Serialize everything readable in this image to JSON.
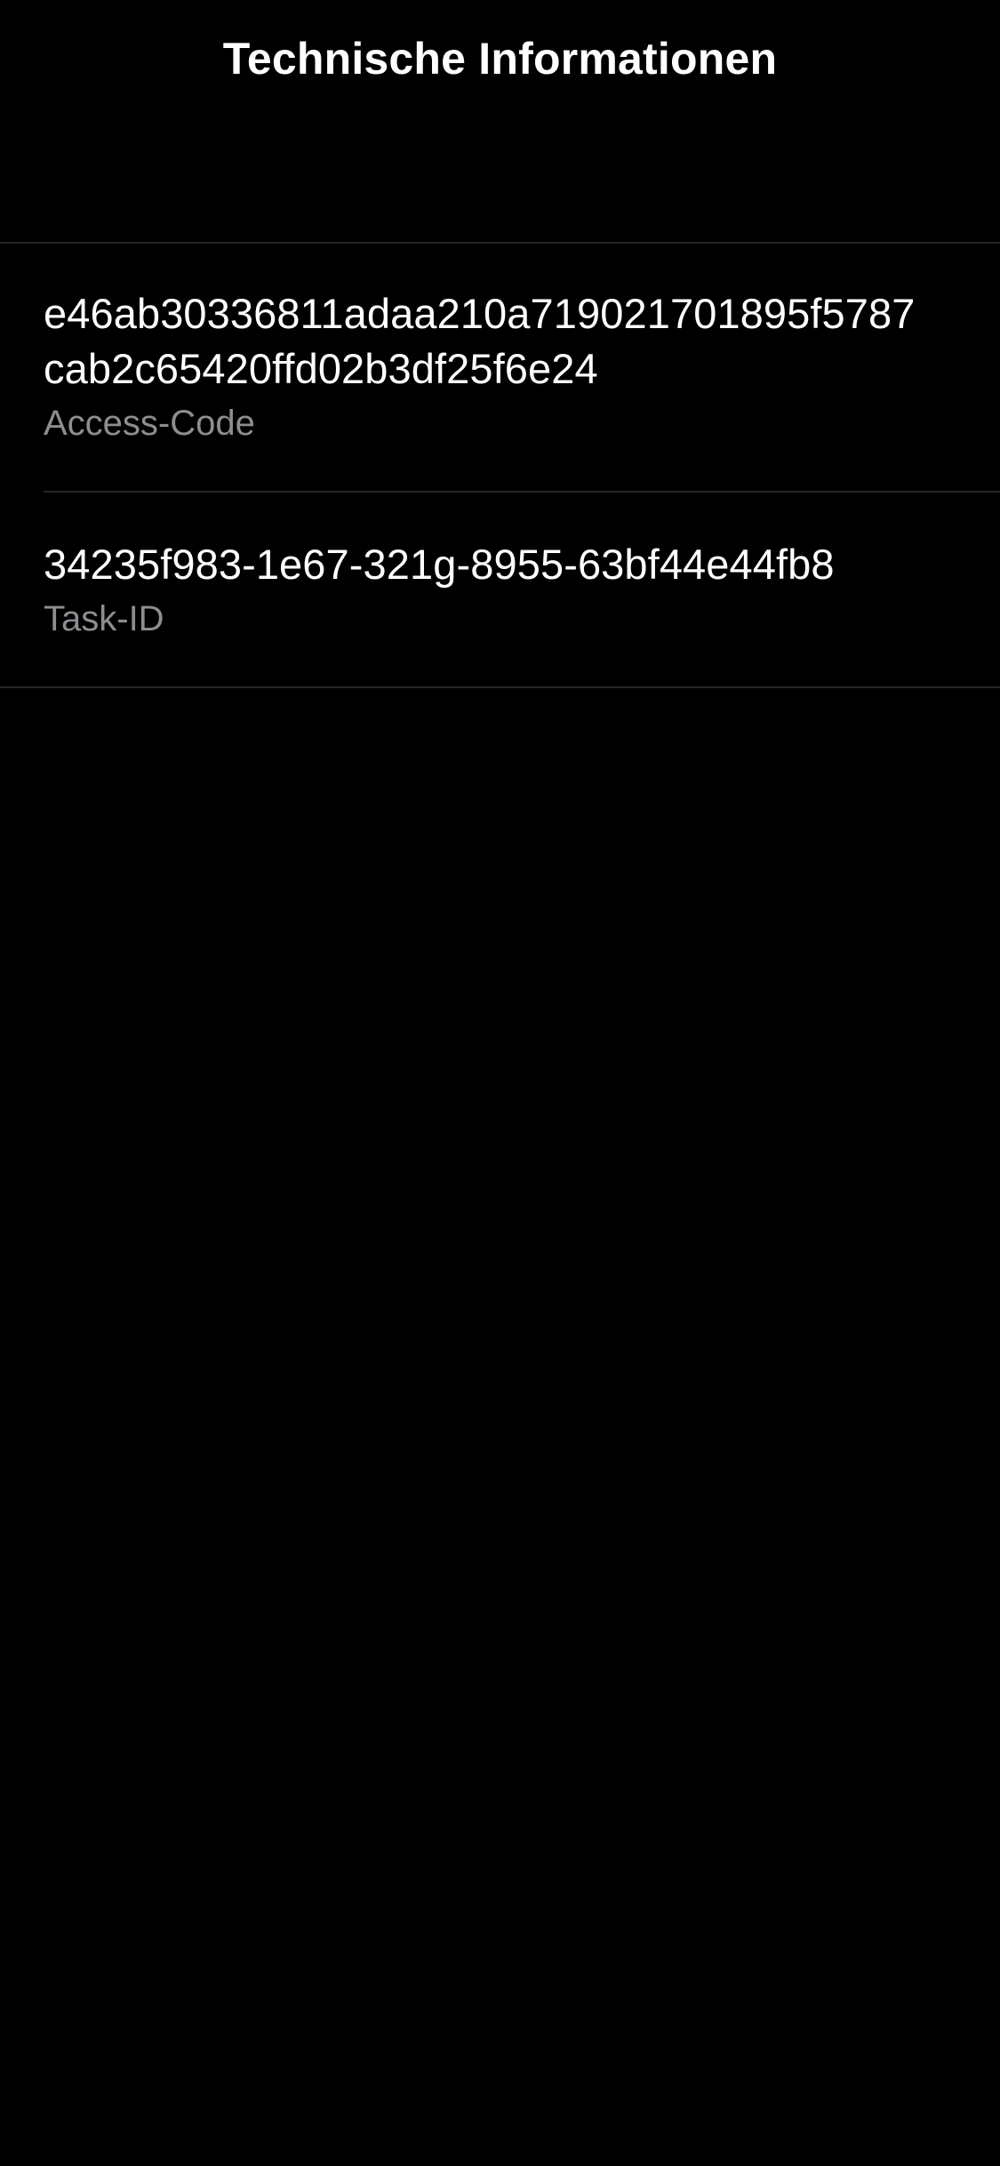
{
  "header": {
    "title": "Technische Informationen"
  },
  "info_list": [
    {
      "value_line1": "e46ab30336811adaa210a719021701895f5787",
      "value_line2": "cab2c65420ffd02b3df25f6e24",
      "label": "Access-Code"
    },
    {
      "value_line1": "34235f983-1e67-321g-8955-63bf44e44fb8",
      "label": "Task-ID"
    }
  ],
  "colors": {
    "background": "#000000",
    "primary_text": "#ffffff",
    "secondary_text": "#8d8d92",
    "separator": "#262628"
  }
}
